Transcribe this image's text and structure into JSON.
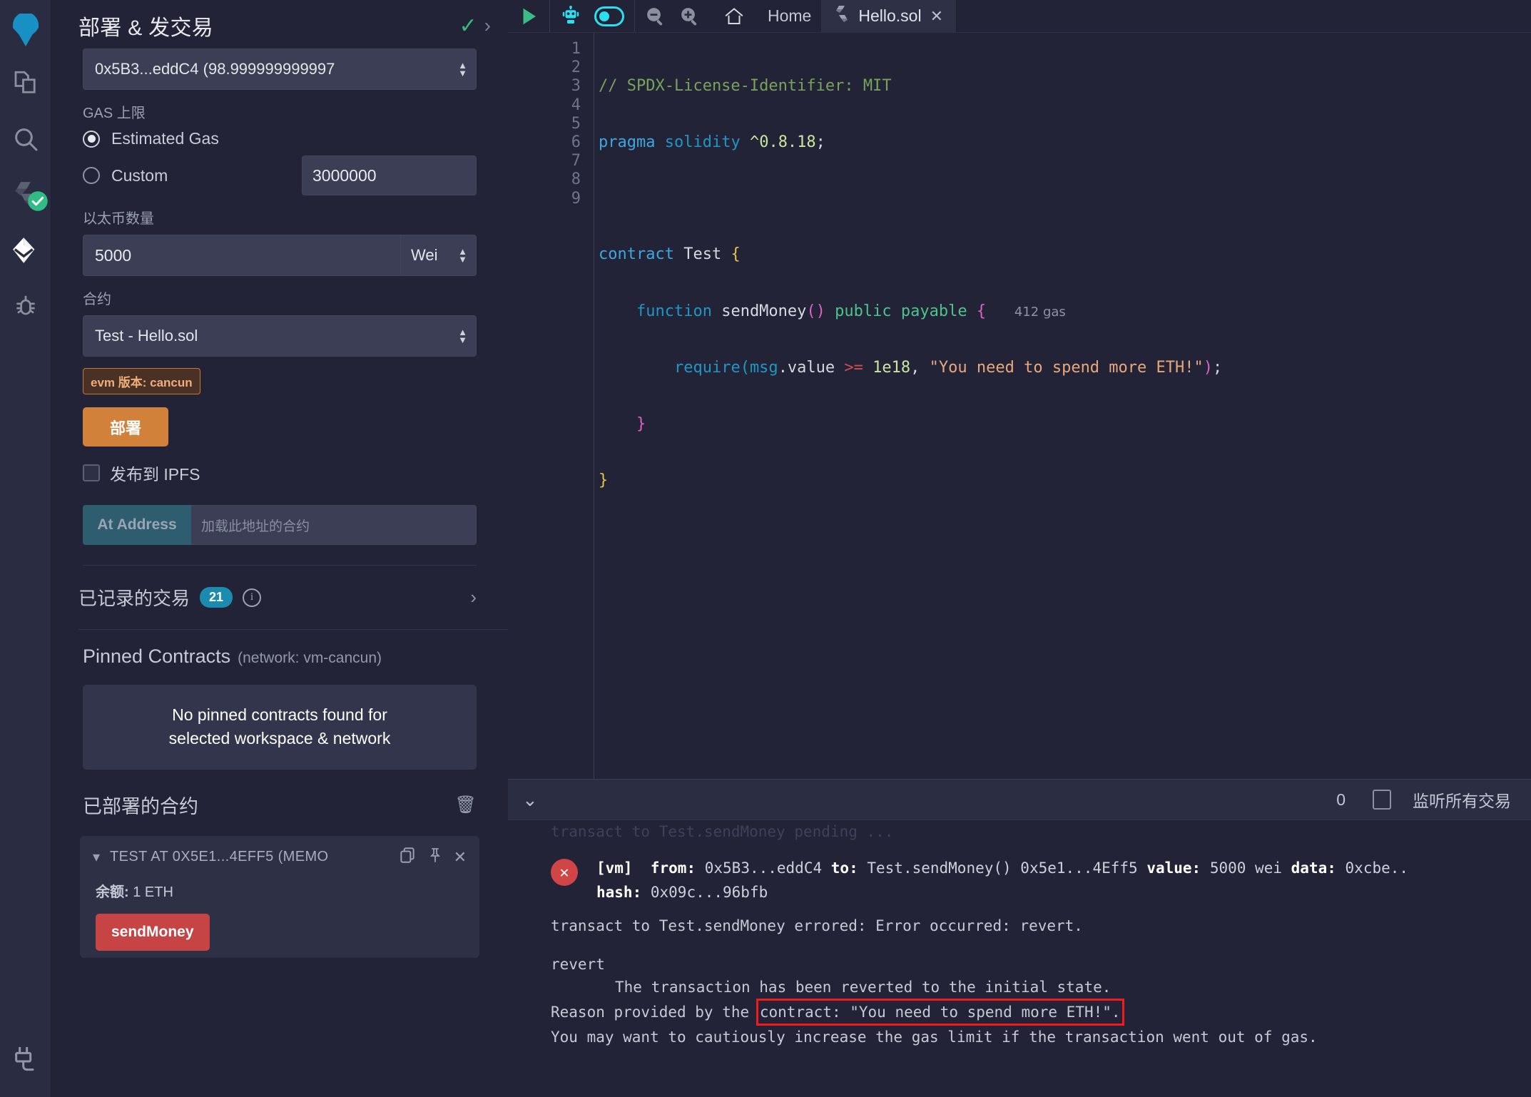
{
  "rail": {
    "items": [
      {
        "name": "remix-logo-icon",
        "label": "Remix"
      },
      {
        "name": "file-explorer-icon",
        "label": "文件浏览器"
      },
      {
        "name": "search-icon",
        "label": "搜索"
      },
      {
        "name": "solidity-compiler-icon",
        "label": "Solidity 编译器"
      },
      {
        "name": "deploy-run-icon",
        "label": "部署 & 发交易"
      },
      {
        "name": "debugger-icon",
        "label": "调试器"
      },
      {
        "name": "plugin-manager-icon",
        "label": "插件管理器"
      }
    ]
  },
  "panel": {
    "title": "部署 & 发交易",
    "account": {
      "value": "0x5B3...eddC4 (98.999999999997"
    },
    "gas_limit": {
      "label": "GAS 上限",
      "estimated_label": "Estimated Gas",
      "custom_label": "Custom",
      "custom_value": "3000000",
      "selected": "estimated"
    },
    "value": {
      "label": "以太币数量",
      "amount": "5000",
      "unit": "Wei"
    },
    "contract": {
      "label": "合约",
      "selected": "Test - Hello.sol",
      "evm_badge": "evm 版本: cancun",
      "deploy_label": "部署",
      "ipfs_label": "发布到 IPFS",
      "at_address_label": "At Address",
      "at_address_placeholder": "加载此地址的合约"
    },
    "recorded": {
      "title": "已记录的交易",
      "count": "21"
    },
    "pinned": {
      "title": "Pinned Contracts",
      "network": "(network: vm-cancun)",
      "empty_line1": "No pinned contracts found for",
      "empty_line2": "selected workspace & network"
    },
    "deployed": {
      "title": "已部署的合约",
      "contract_name": "TEST AT 0X5E1...4EFF5 (MEMO",
      "balance_label": "余额:",
      "balance_value": "1 ETH",
      "function_button": "sendMoney"
    }
  },
  "toolbar": {
    "run_label": "run-script",
    "ai_label": "remix-ai",
    "toggle_label": "ai-toggle",
    "zoom_out_label": "zoom-out",
    "zoom_in_label": "zoom-in",
    "home_label": "Home"
  },
  "tabs": [
    {
      "label": "Hello.sol",
      "icon": "solidity-icon",
      "active": true
    }
  ],
  "editor": {
    "line_numbers": [
      "1",
      "2",
      "3",
      "4",
      "5",
      "6",
      "7",
      "8",
      "9"
    ],
    "gas_hint": "412 gas",
    "code_lines": [
      "// SPDX-License-Identifier: MIT",
      "pragma solidity ^0.8.18;",
      "",
      "contract Test {",
      "    function sendMoney() public payable {",
      "        require(msg.value >= 1e18, \"You need to spend more ETH!\");",
      "    }",
      "}",
      ""
    ]
  },
  "terminal": {
    "count": "0",
    "listen_label": "监听所有交易",
    "pending_line": "transact to Test.sendMoney pending ...",
    "tx_line1_parts": {
      "vm": "[vm]",
      "from_label": "from:",
      "from_value": "0x5B3...eddC4",
      "to_label": "to:",
      "to_value": "Test.sendMoney() 0x5e1...4Eff5",
      "value_label": "value:",
      "value_value": "5000 wei",
      "data_label": "data:",
      "data_value": "0xcbe.."
    },
    "tx_line2_label": "hash:",
    "tx_line2_value": "0x09c...96bfb",
    "error_line": "transact to Test.sendMoney errored: Error occurred: revert.",
    "revert_label": "revert",
    "revert_detail": "The transaction has been reverted to the initial state.",
    "reason_prefix": "Reason provided by the",
    "reason_highlight": "contract: \"You need to spend more ETH!\".",
    "gas_hint_line": "You may want to cautiously increase the gas limit if the transaction went out of gas."
  },
  "colors": {
    "accent_orange": "#d2813a",
    "accent_red": "#c64444",
    "accent_teal": "#2f5d70",
    "badge_blue": "#1b8bb0",
    "highlight_red": "#f21b1b"
  }
}
